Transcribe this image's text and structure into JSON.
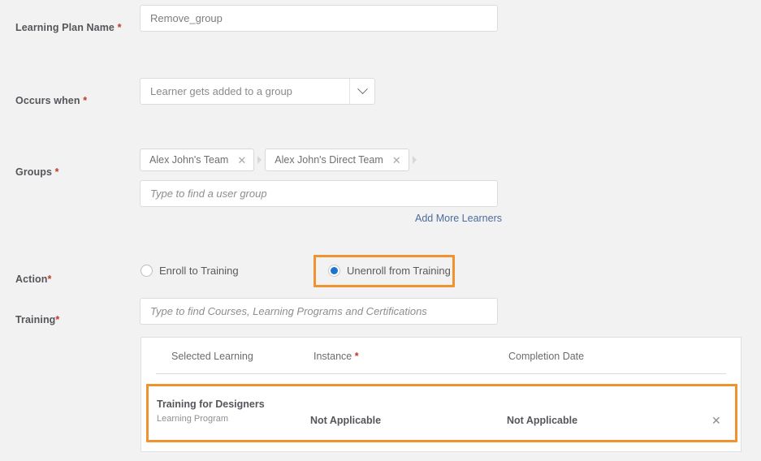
{
  "colors": {
    "page_bg": "#f2f2f2",
    "highlight": "#f0922e",
    "required_asterisk": "#c0392b",
    "link": "#4c6c9c",
    "radio_selected": "#1d74cc"
  },
  "fields": {
    "learning_plan_name": {
      "label": "Learning Plan Name",
      "required_mark": "*",
      "value": "Remove_group"
    },
    "occurs_when": {
      "label": "Occurs when",
      "required_mark": "*",
      "selected": "Learner gets added to a group",
      "arrow_icon": "chevron-down-icon"
    },
    "groups": {
      "label": "Groups",
      "required_mark": "*",
      "chips": [
        {
          "text": "Alex John's Team",
          "remove_icon": "close-icon"
        },
        {
          "text": "Alex John's Direct Team",
          "remove_icon": "close-icon"
        }
      ],
      "placeholder": "Type to find a user group",
      "add_more_link": "Add More Learners"
    },
    "action": {
      "label": "Action",
      "required_mark": "*",
      "options": [
        {
          "label": "Enroll to Training",
          "selected": false,
          "highlighted": false
        },
        {
          "label": "Unenroll from Training",
          "selected": true,
          "highlighted": true
        }
      ]
    },
    "training": {
      "label": "Training",
      "required_mark": "*",
      "placeholder": "Type to find Courses, Learning Programs and Certifications"
    }
  },
  "table": {
    "columns": [
      {
        "label": "Selected Learning",
        "required_mark": ""
      },
      {
        "label": "Instance",
        "required_mark": "*"
      },
      {
        "label": "Completion Date",
        "required_mark": ""
      }
    ],
    "rows": [
      {
        "highlighted": true,
        "selected_learning": "Training for Designers",
        "selected_learning_type": "Learning Program",
        "instance": "Not Applicable",
        "completion_date": "Not Applicable",
        "remove_icon": "close-icon"
      }
    ]
  }
}
